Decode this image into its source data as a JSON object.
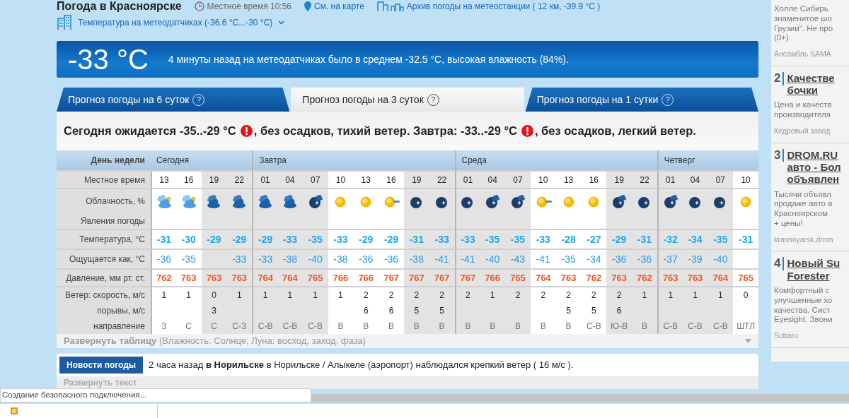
{
  "header": {
    "title": "Погода в Красноярске",
    "local_time": "Местное время  10:56",
    "map_link": "См. на карте",
    "archive_link": "Архив погоды на метеостанции ( 12 км, -39.9 °C )"
  },
  "sensors": {
    "label": "Температура на метеодатчиках (-36.6 °C...-30 °C)"
  },
  "now": {
    "temperature": "-33 °C",
    "message": "4 минуты назад на метеодатчиках было в среднем -32.5 °C, высокая влажность (84%)."
  },
  "tabs": [
    {
      "label": "Прогноз погоды на 6 суток",
      "help": "?",
      "selected": false
    },
    {
      "label": "Прогноз погоды на 3 суток",
      "help": "?",
      "selected": true
    },
    {
      "label": "Прогноз погоды на 1 сутки",
      "help": "?",
      "selected": false
    }
  ],
  "summary": [
    {
      "kind": "text",
      "text": "Сегодня ожидается -35..-29 °C"
    },
    {
      "kind": "warning"
    },
    {
      "kind": "text",
      "text": ", без осадков, тихий ветер. Завтра: -33..-29 °C"
    },
    {
      "kind": "warning"
    },
    {
      "kind": "text",
      "text": ", без осадков, легкий ветер."
    }
  ],
  "table": {
    "row_labels": {
      "day": "День недели",
      "time": "Местное время",
      "clouds": "Облачность, %",
      "phenomena": "Явления погоды",
      "temp": "Температура, °C",
      "feels": "Ощущается как, °C",
      "pressure": "Давление, мм рт. ст.",
      "wind": "Ветер: скорость, м/с",
      "gust": "порывы, м/с",
      "dir": "направление"
    },
    "days": [
      {
        "label": "Сегодня",
        "slots": [
          {
            "time": "13",
            "daytime": true,
            "kind": "clouds-day",
            "temp": "-31",
            "feels": "-36",
            "pressure": "762",
            "wind": "1",
            "dir": "З"
          },
          {
            "time": "16",
            "daytime": true,
            "kind": "clouds-day",
            "temp": "-30",
            "feels": "-35",
            "pressure": "763",
            "wind": "1",
            "dir": "С"
          },
          {
            "time": "19",
            "daytime": false,
            "kind": "clouds-night",
            "temp": "-29",
            "pressure": "763",
            "wind": "0",
            "gust": "3",
            "dir": "С"
          },
          {
            "time": "22",
            "daytime": false,
            "kind": "clouds-night",
            "temp": "-29",
            "feels": "-33",
            "pressure": "763",
            "wind": "1",
            "dir": "С-З"
          }
        ]
      },
      {
        "label": "Завтра",
        "slots": [
          {
            "time": "01",
            "daytime": false,
            "kind": "clouds-night",
            "temp": "-29",
            "feels": "-33",
            "pressure": "764",
            "wind": "1",
            "dir": "С-В"
          },
          {
            "time": "04",
            "daytime": false,
            "kind": "clouds-night",
            "temp": "-33",
            "feels": "-38",
            "pressure": "764",
            "wind": "1",
            "dir": "С-В"
          },
          {
            "time": "07",
            "daytime": false,
            "kind": "moon-cloud",
            "temp": "-35",
            "feels": "-40",
            "pressure": "765",
            "wind": "1",
            "dir": "С-В"
          },
          {
            "time": "10",
            "daytime": true,
            "kind": "sun",
            "temp": "-33",
            "feels": "-38",
            "pressure": "766",
            "wind": "1",
            "dir": "В"
          },
          {
            "time": "13",
            "daytime": true,
            "kind": "sun",
            "temp": "-29",
            "feels": "-36",
            "pressure": "766",
            "wind": "2",
            "gust": "6",
            "dir": "В"
          },
          {
            "time": "16",
            "daytime": true,
            "kind": "sun-cloud",
            "temp": "-29",
            "feels": "-36",
            "pressure": "767",
            "wind": "2",
            "gust": "6",
            "dir": "В"
          },
          {
            "time": "19",
            "daytime": false,
            "kind": "moon",
            "temp": "-31",
            "feels": "-38",
            "pressure": "767",
            "wind": "2",
            "gust": "5",
            "dir": "В"
          },
          {
            "time": "22",
            "daytime": false,
            "kind": "moon",
            "temp": "-33",
            "feels": "-41",
            "pressure": "767",
            "wind": "2",
            "gust": "5",
            "dir": "В"
          }
        ]
      },
      {
        "label": "Среда",
        "slots": [
          {
            "time": "01",
            "daytime": false,
            "kind": "moon",
            "temp": "-33",
            "feels": "-41",
            "pressure": "767",
            "wind": "2",
            "dir": "В"
          },
          {
            "time": "04",
            "daytime": false,
            "kind": "moon-cloud",
            "temp": "-35",
            "feels": "-40",
            "pressure": "766",
            "wind": "1",
            "dir": "В"
          },
          {
            "time": "07",
            "daytime": false,
            "kind": "moon-cloud",
            "temp": "-35",
            "feels": "-43",
            "pressure": "765",
            "wind": "2",
            "dir": "В"
          },
          {
            "time": "10",
            "daytime": true,
            "kind": "sun-cloud",
            "temp": "-33",
            "feels": "-41",
            "pressure": "764",
            "wind": "2",
            "dir": "В"
          },
          {
            "time": "13",
            "daytime": true,
            "kind": "sun",
            "temp": "-28",
            "feels": "-35",
            "pressure": "763",
            "wind": "2",
            "gust": "5",
            "dir": "В"
          },
          {
            "time": "16",
            "daytime": true,
            "kind": "sun",
            "temp": "-27",
            "feels": "-34",
            "pressure": "762",
            "wind": "2",
            "gust": "5",
            "dir": "С-В"
          },
          {
            "time": "19",
            "daytime": false,
            "kind": "moon-cloud",
            "temp": "-29",
            "feels": "-36",
            "pressure": "763",
            "wind": "2",
            "gust": "6",
            "dir": "Ю-В"
          },
          {
            "time": "22",
            "daytime": false,
            "kind": "moon",
            "temp": "-31",
            "feels": "-36",
            "pressure": "762",
            "wind": "1",
            "dir": "В"
          }
        ]
      },
      {
        "label": "Четверг",
        "slots": [
          {
            "time": "01",
            "daytime": false,
            "kind": "moon-cloud",
            "temp": "-32",
            "feels": "-37",
            "pressure": "763",
            "wind": "1",
            "dir": "С-В"
          },
          {
            "time": "04",
            "daytime": false,
            "kind": "moon",
            "temp": "-34",
            "feels": "-39",
            "pressure": "763",
            "wind": "1",
            "dir": "С-В"
          },
          {
            "time": "07",
            "daytime": false,
            "kind": "moon",
            "temp": "-35",
            "feels": "-40",
            "pressure": "764",
            "wind": "1",
            "dir": "С-В"
          },
          {
            "time": "10",
            "daytime": true,
            "kind": "sun",
            "temp": "-31",
            "pressure": "765",
            "wind": "0",
            "dir": "ШТЛ"
          }
        ]
      }
    ],
    "expand": "**Развернуть таблицу** (Влажность. Солнце, Луна: восход, заход, фаза)"
  },
  "news": {
    "label": "Новости погоды",
    "text": "2 часа назад **в Норильске** в Норильске / Алыкеле (аэропорт) наблюдался крепкий ветер ( 16 м/с ).",
    "expand": "Развернуть текст"
  },
  "ads": [
    {
      "text": [
        "Холле Сибирь",
        "знаменитое шо",
        "Грузии\". Не про",
        "(0+)"
      ],
      "source": "Ансамбль SAMA"
    },
    {
      "number": "2",
      "title": [
        "Качестве",
        "бочки"
      ],
      "text": [
        "Цена и качеств",
        "производителя"
      ],
      "source": "Кедровый завод"
    },
    {
      "number": "3",
      "title": [
        "DROM.RU",
        "авто - Бол",
        "объявлен"
      ],
      "text": [
        "Тысячи объявл",
        "продаже авто в",
        "Красноярском",
        "+ цены!"
      ],
      "source": "krasnoyarsk.drom"
    },
    {
      "number": "4",
      "title": [
        "Новый Su",
        "Forester"
      ],
      "text": [
        "Комфортный с",
        "улучшенные хо",
        "качества. Сист",
        "Eyesight. Звони"
      ],
      "source": "Subaru"
    }
  ],
  "status_bar": {
    "text": "Создание безопасного подключения..."
  }
}
